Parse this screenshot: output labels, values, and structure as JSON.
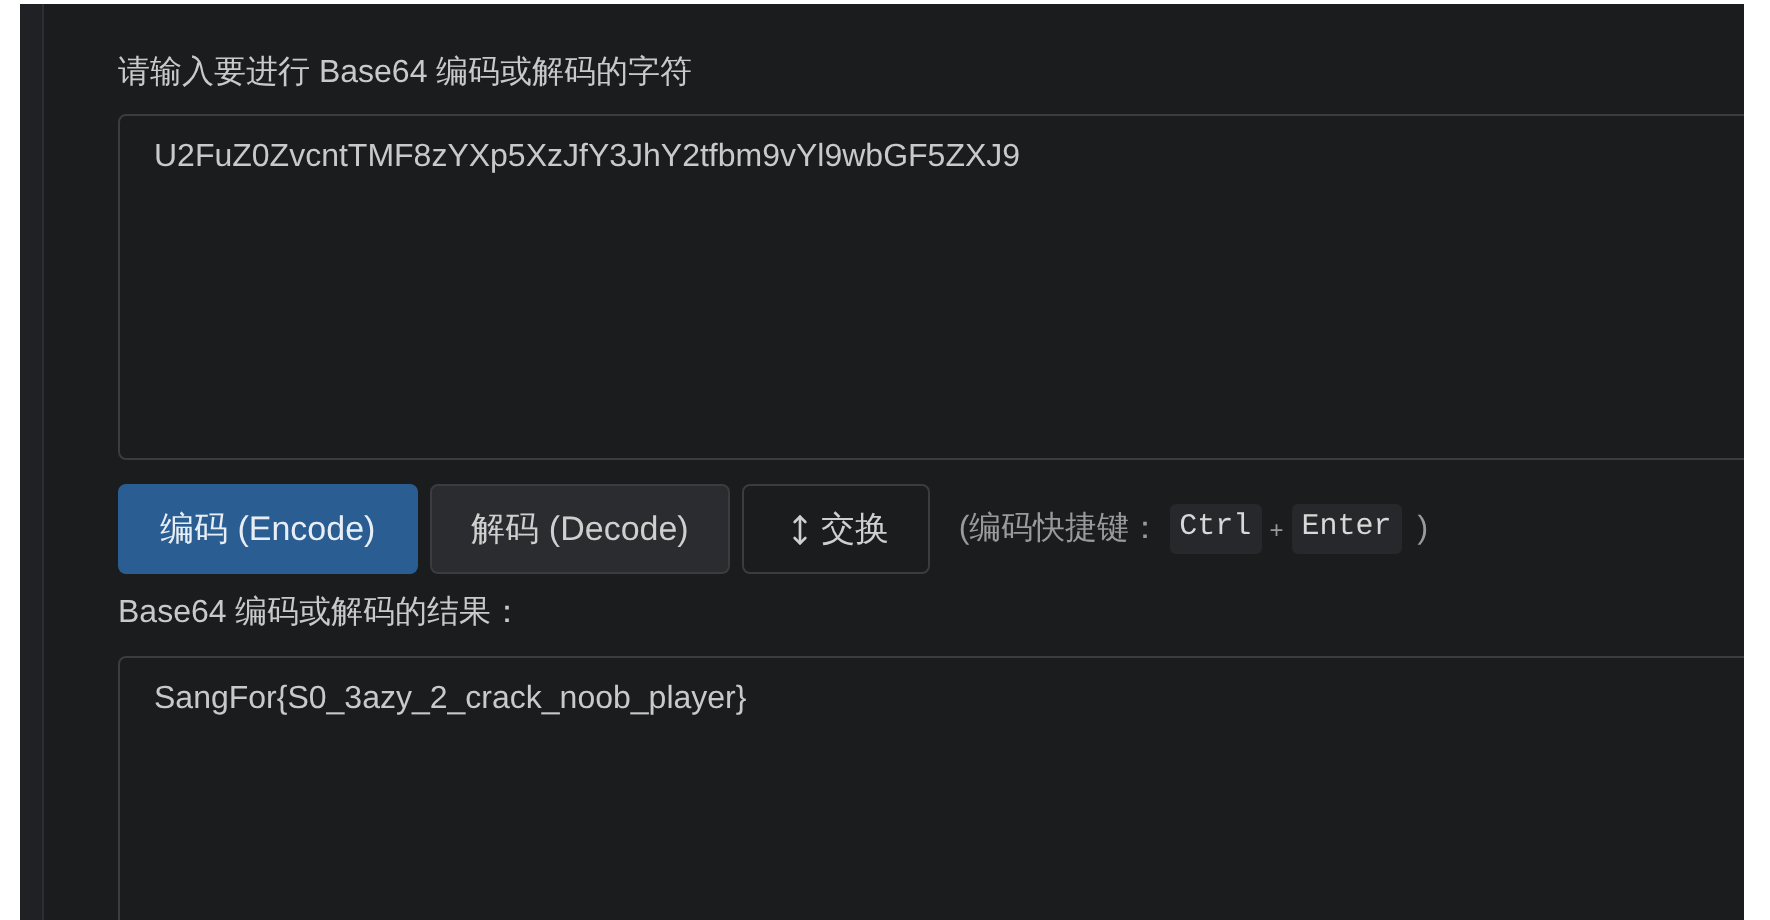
{
  "input": {
    "label": "请输入要进行 Base64 编码或解码的字符",
    "value": "U2FuZ0ZvcntTMF8zYXp5XzJfY3JhY2tfbm9vYl9wbGF5ZXJ9"
  },
  "buttons": [
    {
      "label": "编码 (Encode)",
      "kind": "primary"
    },
    {
      "label": "解码 (Decode)",
      "kind": "default"
    },
    {
      "label": "交换",
      "kind": "swap"
    }
  ],
  "shortcut": {
    "prefix": "(编码快捷键：",
    "keys": [
      "Ctrl",
      "Enter"
    ],
    "separator": "+",
    "suffix": ")"
  },
  "output": {
    "label": "Base64 编码或解码的结果：",
    "value": "SangFor{S0_3azy_2_crack_noob_player}"
  }
}
